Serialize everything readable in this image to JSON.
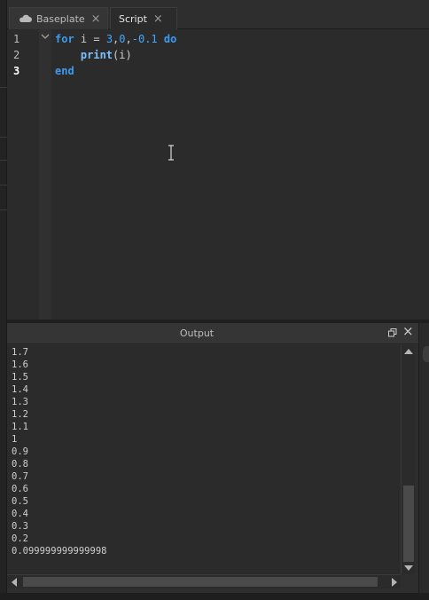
{
  "tabs": [
    {
      "label": "Baseplate",
      "icon": "cloud-icon",
      "close": "×"
    },
    {
      "label": "Script",
      "close": "×"
    }
  ],
  "editor": {
    "line_numbers": [
      "1",
      "2",
      "3"
    ],
    "current_line": "3",
    "code": {
      "l1_for": "for",
      "l1_var": " i = ",
      "l1_start": "3",
      "l1_c1": ",",
      "l1_end": "0",
      "l1_c2": ",",
      "l1_step": "-0.1",
      "l1_do": " do",
      "l2_indent": "    ",
      "l2_fn": "print",
      "l2_args": "(i)",
      "l3_end": "end"
    }
  },
  "output": {
    "title": "Output",
    "lines": [
      "1.7",
      "1.6",
      "1.5",
      "1.4",
      "1.3",
      "1.2",
      "1.1",
      "1",
      "0.9",
      "0.8",
      "0.7",
      "0.6",
      "0.5",
      "0.4",
      "0.3",
      "0.2",
      "0.099999999999998"
    ]
  },
  "colors": {
    "keyword": "#3c9bf0",
    "number": "#43a8ff",
    "background": "#2b2b2b"
  }
}
